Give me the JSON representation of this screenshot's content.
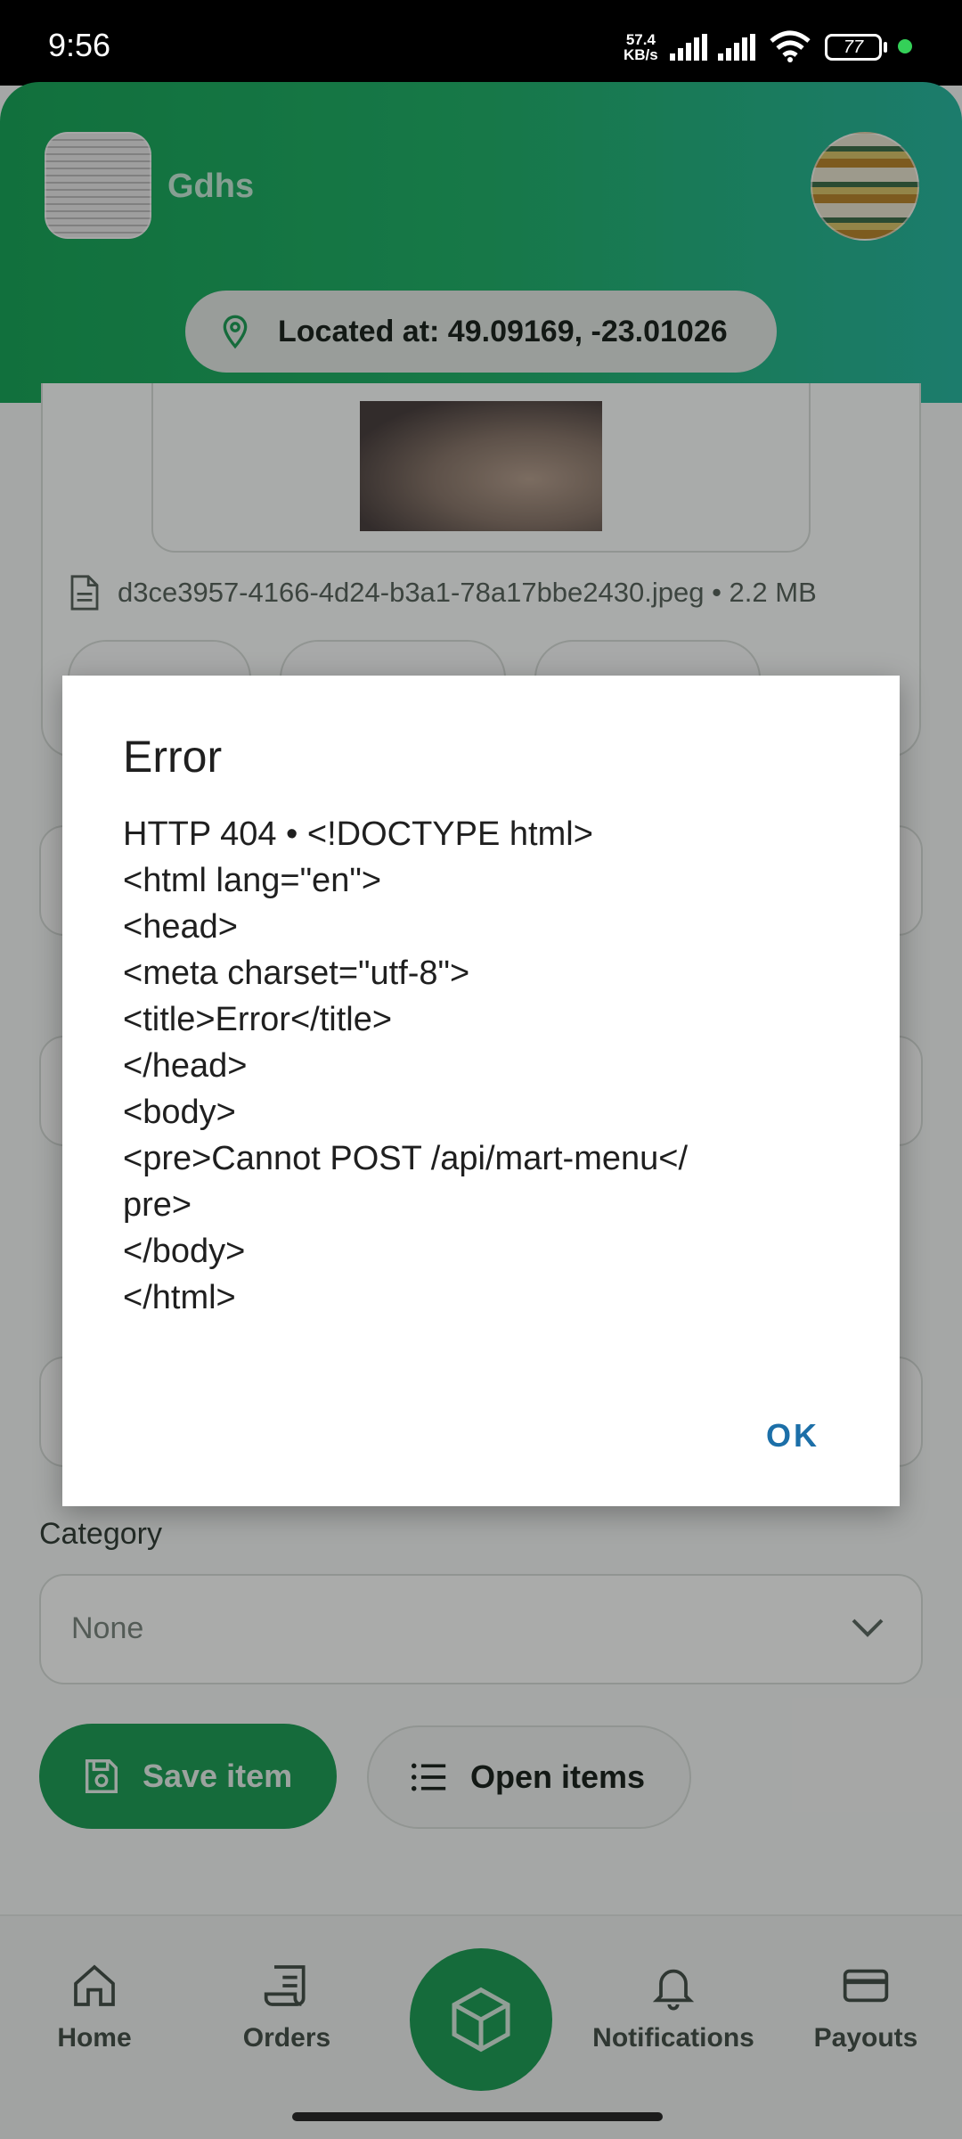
{
  "status_bar": {
    "time": "9:56",
    "net_speed_value": "57.4",
    "net_speed_unit": "KB/s",
    "battery": "77"
  },
  "header": {
    "store_name": "Gdhs",
    "location_text": "Located at: 49.09169, -23.01026"
  },
  "upload": {
    "file_info": "d3ce3957-4166-4d24-b3a1-78a17bbe2430.jpeg • 2.2 MB"
  },
  "form": {
    "category_label": "Category",
    "category_value": "None"
  },
  "actions": {
    "save_label": "Save item",
    "open_label": "Open items"
  },
  "nav": {
    "home": "Home",
    "orders": "Orders",
    "notifications": "Notifications",
    "payouts": "Payouts"
  },
  "dialog": {
    "title": "Error",
    "message": "HTTP 404 • <!DOCTYPE html>\n<html lang=\"en\">\n<head>\n<meta charset=\"utf-8\">\n<title>Error</title>\n</head>\n<body>\n<pre>Cannot POST /api/mart-menu</\npre>\n</body>\n</html>",
    "ok_label": "OK"
  },
  "colors": {
    "brand_green": "#1f9e57",
    "dialog_button": "#1c6fa8"
  }
}
